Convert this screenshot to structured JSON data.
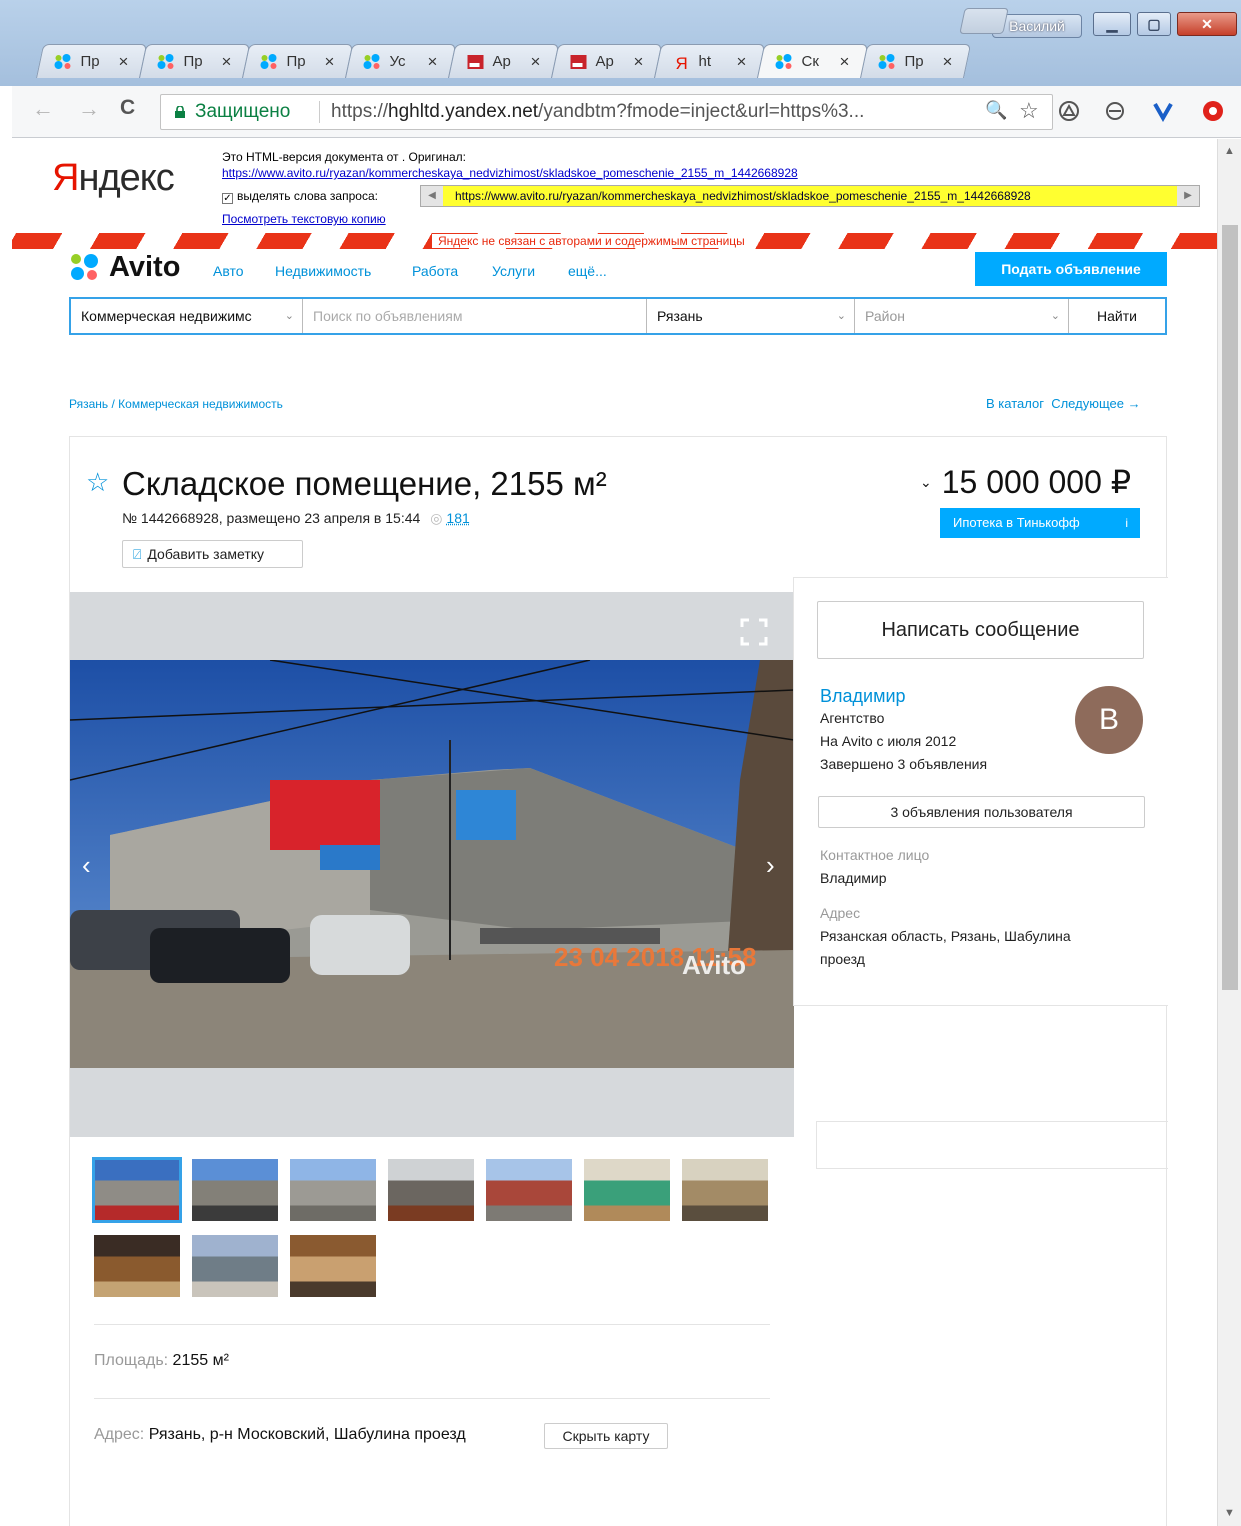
{
  "window": {
    "user_name": "Василий",
    "min_glyph": "▁",
    "max_glyph": "▢",
    "close_glyph": "✕"
  },
  "tabs": [
    {
      "icon": "avito-icon",
      "title": "Пр",
      "close": "×"
    },
    {
      "icon": "avito-icon",
      "title": "Пр",
      "close": "×"
    },
    {
      "icon": "avito-icon",
      "title": "Пр",
      "close": "×"
    },
    {
      "icon": "avito-icon",
      "title": "Ус",
      "close": "×"
    },
    {
      "icon": "red-doc-icon",
      "title": "Ар",
      "close": "×"
    },
    {
      "icon": "red-doc-icon",
      "title": "Ар",
      "close": "×"
    },
    {
      "icon": "yandex-icon",
      "title": "ht",
      "close": "×"
    },
    {
      "icon": "avito-icon",
      "title": "Ск",
      "close": "×",
      "active": true
    },
    {
      "icon": "avito-icon",
      "title": "Пр",
      "close": "×"
    }
  ],
  "toolbar": {
    "back": "←",
    "forward": "→",
    "reload": "C",
    "secure_label": "Защищено",
    "url_prefix": "https://",
    "url_host": "hghltd.yandex.net",
    "url_rest": "/yandbtm?fmode=inject&url=https%3...",
    "zoom": "🔍",
    "star": "☆"
  },
  "yandex": {
    "logo_first": "Я",
    "logo_rest": "ндекс",
    "line1": "Это HTML-версия документа от . Оригинал:",
    "original_link": "https://www.avito.ru/ryazan/kommercheskaya_nedvizhimost/skladskoe_pomeschenie_2155_m_1442668928",
    "highlight_label": "выделять слова запроса:",
    "highlight_url": "https://www.avito.ru/ryazan/kommercheskaya_nedvizhimost/skladskoe_pomeschenie_2155_m_1442668928",
    "text_copy": "Посмотреть текстовую копию",
    "disclaimer": "Яндекс не связан с авторами и содержимым страницы"
  },
  "avito": {
    "logo": "Avito",
    "nav": [
      "Авто",
      "Недвижимость",
      "Работа",
      "Услуги",
      "ещё..."
    ],
    "post_ad": "Подать объявление",
    "search": {
      "category": "Коммерческая недвижимс",
      "query_placeholder": "Поиск по объявлениям",
      "city": "Рязань",
      "district_placeholder": "Район",
      "find": "Найти"
    },
    "breadcrumb": "Рязань / Коммерческая недвижимость",
    "catalog_link": "В каталог",
    "next_link": "Следующее →"
  },
  "listing": {
    "title": "Складское помещение, 2155 м²",
    "meta": "№ 1442668928, размещено 23 апреля в 15:44",
    "views_icon": "◎",
    "views": "181",
    "add_note": "Добавить заметку",
    "price": "15 000 000 ₽",
    "mortgage": "Ипотека в Тинькофф",
    "mortgage_info": "i",
    "photo_stamp": "23 04 2018 11:58",
    "photo_watermark": "Avito",
    "photo_count": 10,
    "params": [
      {
        "label": "Площадь:",
        "value": " 2155 м²"
      },
      {
        "label": "Адрес:",
        "value": " Рязань, р-н Московский, Шабулина проезд"
      }
    ],
    "hide_map": "Скрыть карту"
  },
  "seller": {
    "write_message": "Написать сообщение",
    "name": "Владимир",
    "type": "Агентство",
    "since": "На Avito с июля 2012",
    "completed": "Завершено 3 объявления",
    "avatar_letter": "В",
    "user_ads": "3 объявления пользователя",
    "contact_label": "Контактное лицо",
    "contact_value": "Владимир",
    "address_label": "Адрес",
    "address_line1": "Рязанская область, Рязань, Шабулина",
    "address_line2": "проезд"
  },
  "colors": {
    "avito_blue": "#00aaff",
    "link_blue": "#0091d9",
    "yandex_red": "#e61400",
    "secure_green": "#0b8043"
  }
}
